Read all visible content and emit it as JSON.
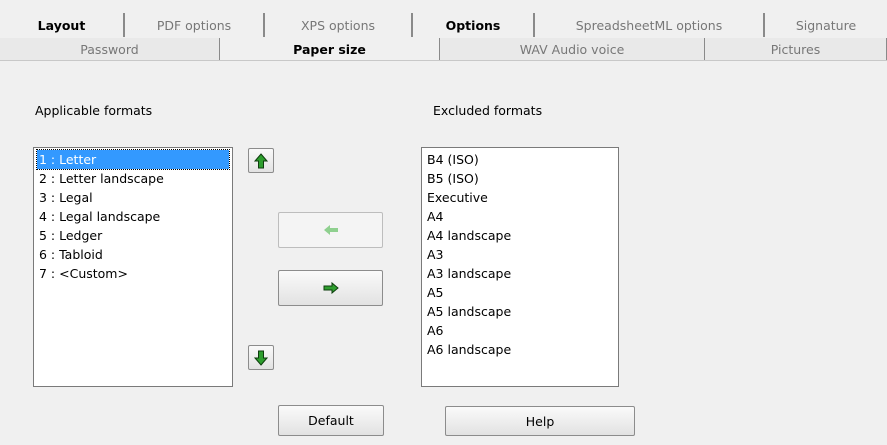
{
  "tabs_row1": [
    {
      "label": "Layout",
      "bold": true
    },
    {
      "label": "PDF options",
      "bold": false
    },
    {
      "label": "XPS options",
      "bold": false
    },
    {
      "label": "Options",
      "bold": true
    },
    {
      "label": "SpreadsheetML options",
      "bold": false
    },
    {
      "label": "Signature",
      "bold": false
    }
  ],
  "tabs_row2": [
    {
      "label": "Password",
      "active": false
    },
    {
      "label": "Paper size",
      "active": true
    },
    {
      "label": "WAV Audio voice",
      "active": false
    },
    {
      "label": "Pictures",
      "active": false
    }
  ],
  "applicable": {
    "label": "Applicable formats",
    "items": [
      "1 : Letter",
      "2 : Letter landscape",
      "3 : Legal",
      "4 : Legal landscape",
      "5 : Ledger",
      "6 : Tabloid",
      "7 : <Custom>"
    ],
    "selected_index": 0
  },
  "excluded": {
    "label": "Excluded formats",
    "items": [
      "B4 (ISO)",
      "B5 (ISO)",
      "Executive",
      "A4",
      "A4 landscape",
      "A3",
      "A3 landscape",
      "A5",
      "A5 landscape",
      "A6",
      "A6 landscape"
    ]
  },
  "buttons": {
    "default_label": "Default",
    "help_label": "Help"
  },
  "colors": {
    "arrow_green": "#2e9e2e",
    "arrow_disabled": "#8fd08f",
    "selection": "#3399ff"
  },
  "icons": {
    "move_up": "arrow-up-icon",
    "move_down": "arrow-down-icon",
    "move_left": "arrow-left-icon",
    "move_right": "arrow-right-icon"
  }
}
